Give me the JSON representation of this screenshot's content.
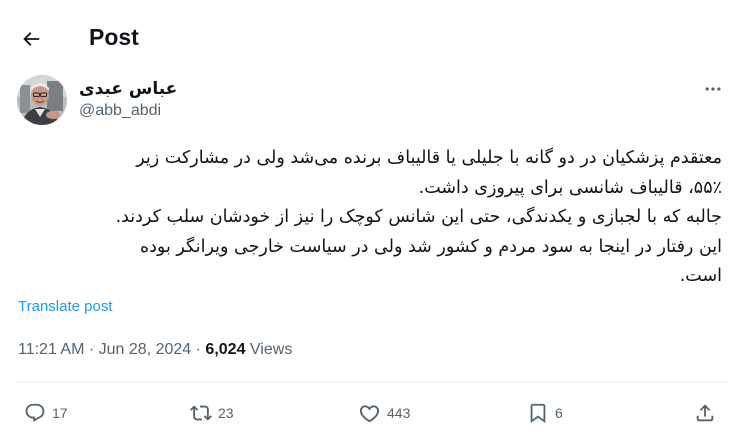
{
  "header": {
    "title": "Post",
    "back_icon": "arrow-left-icon"
  },
  "author": {
    "display_name": "عباس عبدی",
    "handle": "@abb_abdi",
    "avatar_icon": "avatar-photo"
  },
  "tweet": {
    "lines": [
      "معتقدم پزشکیان در دو گانه با جلیلی یا قالیباف برنده می‌شد ولی در مشارکت زیر",
      "۵۵٪، قالیباف شانسی برای پیروزی داشت.",
      "جالبه که با لجبازی و یکدندگی، حتی این شانس کوچک را نیز از خودشان سلب کردند.",
      "این رفتار در اینجا به سود مردم و کشور شد ولی در سیاست خارجی ویرانگر بوده",
      "است."
    ]
  },
  "translate_label": "Translate post",
  "meta": {
    "time": "11:21 AM",
    "separator": "·",
    "date": "Jun 28, 2024",
    "views_count": "6,024",
    "views_label": "Views"
  },
  "actions": {
    "replies": "17",
    "reposts": "23",
    "likes": "443",
    "bookmarks": "6"
  },
  "colors": {
    "text": "#0f1419",
    "secondary": "#536471",
    "link": "#1d9bf0",
    "divider": "#eff3f4"
  }
}
